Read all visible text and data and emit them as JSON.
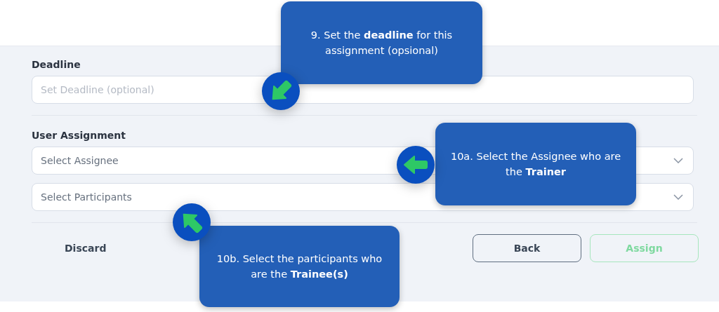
{
  "form": {
    "deadline": {
      "label": "Deadline",
      "placeholder": "Set Deadline (optional)"
    },
    "user_assignment": {
      "label": "User Assignment",
      "selects": [
        {
          "placeholder": "Select Assignee"
        },
        {
          "placeholder": "Select Participants"
        }
      ]
    },
    "actions": [
      {
        "label": "Discard",
        "kind": "text",
        "disabled": false
      },
      {
        "label": "Back",
        "kind": "outline",
        "disabled": false
      },
      {
        "label": "Assign",
        "kind": "primary",
        "disabled": true
      }
    ]
  },
  "callouts": [
    {
      "text": "9. Set the **deadline** for this assignment (opsional)",
      "kind": "down-left"
    },
    {
      "text": "10a. Select the Assignee who are the **Trainer**",
      "kind": "left"
    },
    {
      "text": "10b. Select the participants who are the **Trainee(s)**",
      "kind": "up-left"
    }
  ]
}
